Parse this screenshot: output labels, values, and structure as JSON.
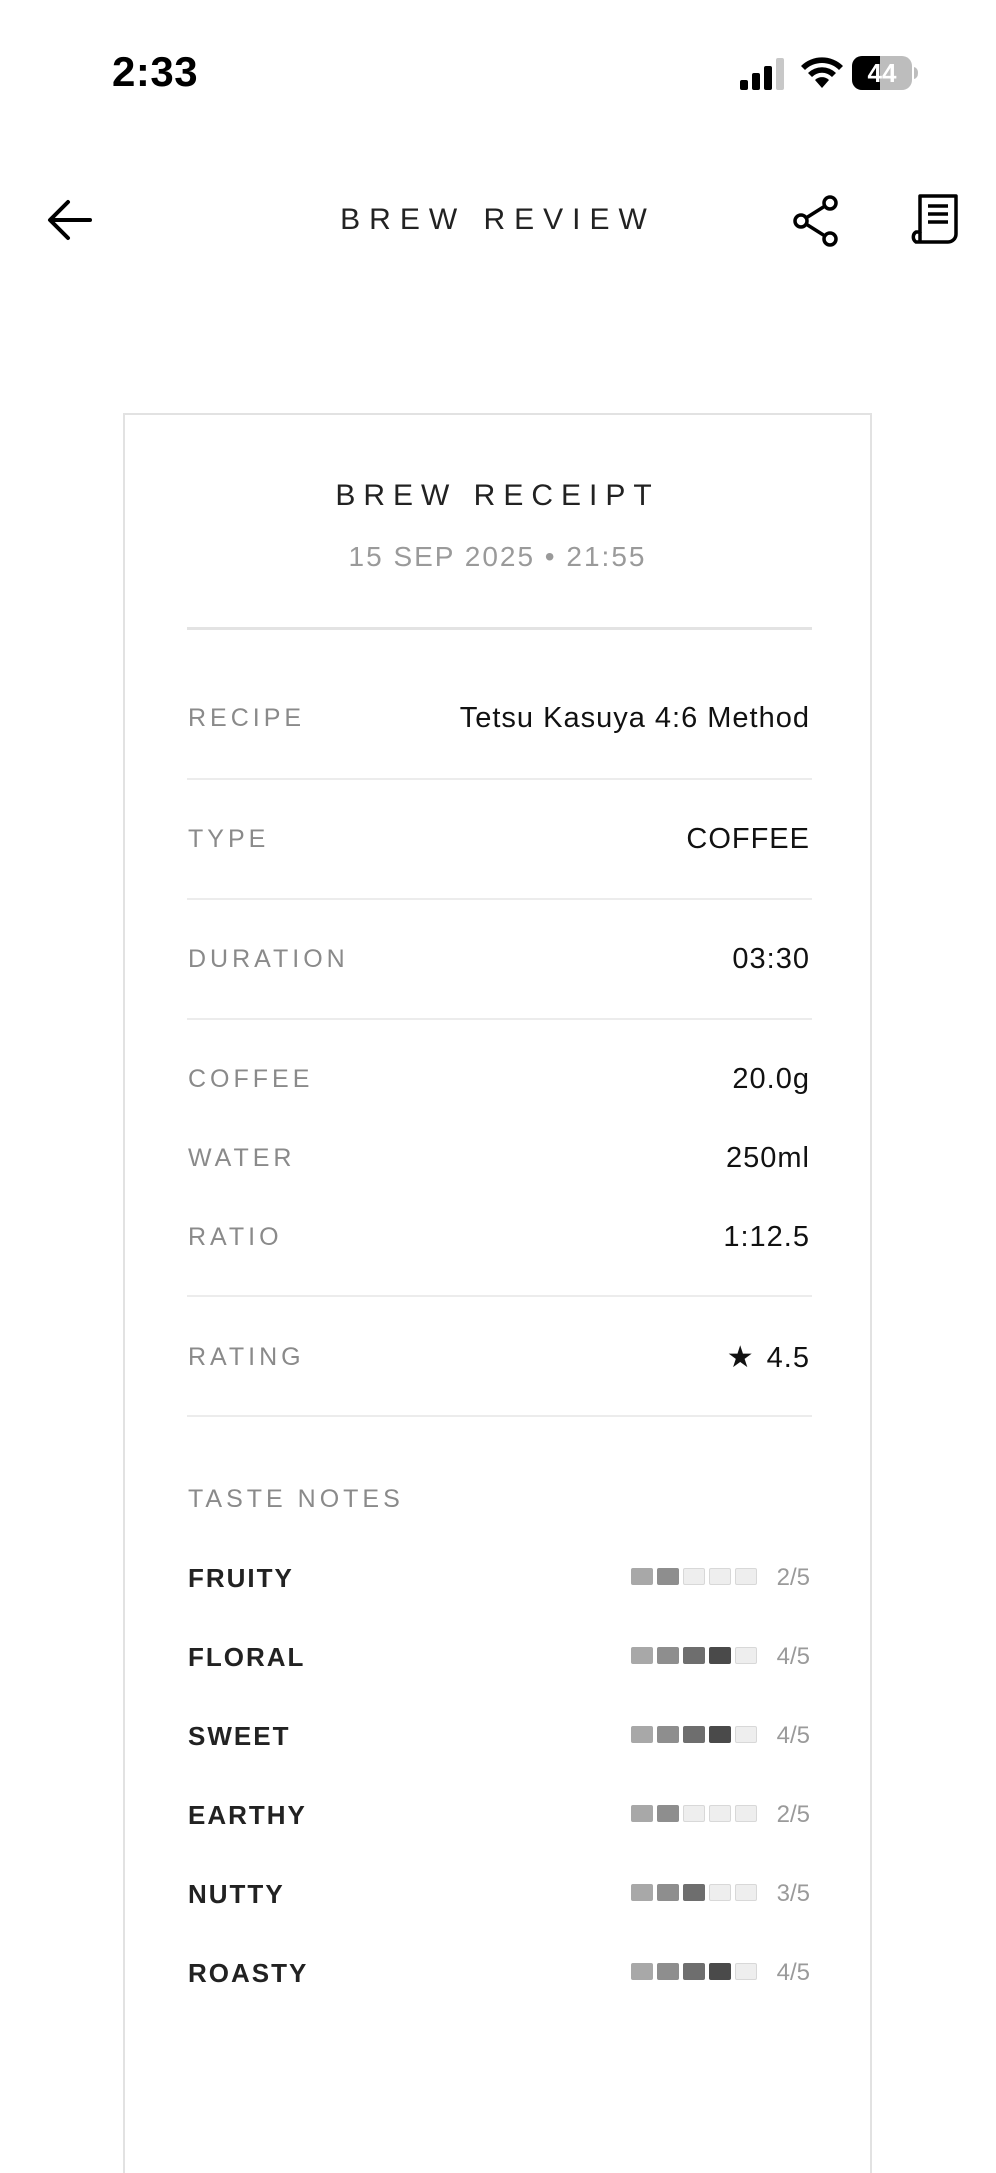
{
  "status_bar": {
    "time": "2:33",
    "battery": "44"
  },
  "header": {
    "title": "BREW REVIEW",
    "back_icon": "arrow-left-icon",
    "share_icon": "share-icon",
    "receipt_icon": "receipt-icon"
  },
  "receipt": {
    "title": "BREW RECEIPT",
    "date": "15 SEP 2025 • 21:55",
    "recipe": {
      "label": "RECIPE",
      "value": "Tetsu Kasuya 4:6 Method"
    },
    "type": {
      "label": "TYPE",
      "value": "COFFEE"
    },
    "duration": {
      "label": "DURATION",
      "value": "03:30"
    },
    "coffee": {
      "label": "COFFEE",
      "value": "20.0g"
    },
    "water": {
      "label": "WATER",
      "value": "250ml"
    },
    "ratio": {
      "label": "RATIO",
      "value": "1:12.5"
    },
    "rating": {
      "label": "RATING",
      "star": "★",
      "value": "4.5"
    },
    "taste_heading": "TASTE NOTES",
    "taste_notes": [
      {
        "name": "FRUITY",
        "level": 2,
        "score": "2/5"
      },
      {
        "name": "FLORAL",
        "level": 4,
        "score": "4/5"
      },
      {
        "name": "SWEET",
        "level": 4,
        "score": "4/5"
      },
      {
        "name": "EARTHY",
        "level": 2,
        "score": "2/5"
      },
      {
        "name": "NUTTY",
        "level": 3,
        "score": "3/5"
      },
      {
        "name": "ROASTY",
        "level": 4,
        "score": "4/5"
      }
    ],
    "bar_colors": {
      "filled": [
        "#a8a8a8",
        "#8e8e8e",
        "#6e6e6e",
        "#4a4a4a",
        "#2e2e2e"
      ],
      "empty": "#eeeeee",
      "empty_border": "#d8d8d8"
    }
  }
}
